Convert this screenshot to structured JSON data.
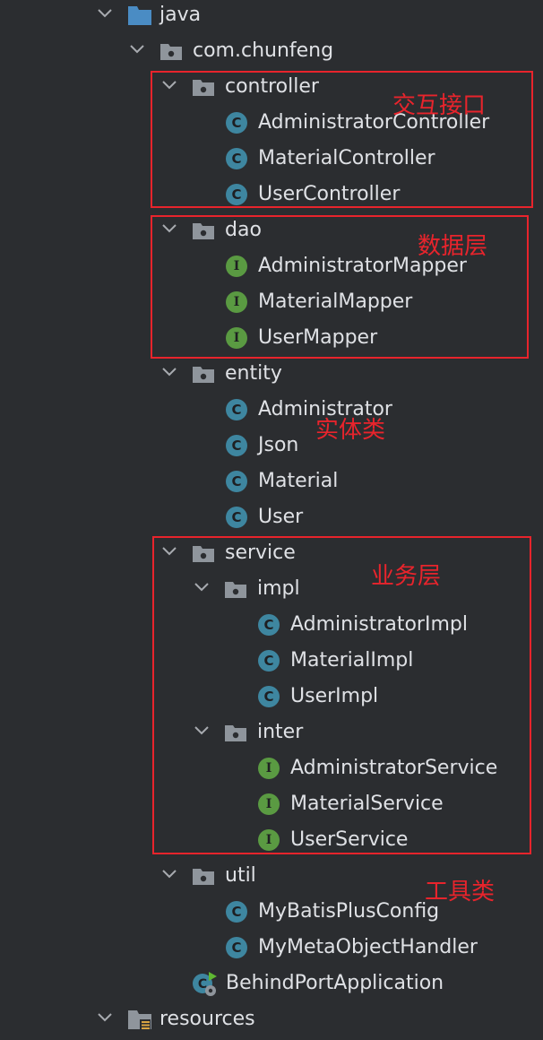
{
  "tree": {
    "java": "java",
    "com_chunfeng": "com.chunfeng",
    "controller": "controller",
    "controller_items": [
      "AdministratorController",
      "MaterialController",
      "UserController"
    ],
    "dao": "dao",
    "dao_items": [
      "AdministratorMapper",
      "MaterialMapper",
      "UserMapper"
    ],
    "entity": "entity",
    "entity_items": [
      "Administrator",
      "Json",
      "Material",
      "User"
    ],
    "service": "service",
    "impl": "impl",
    "impl_items": [
      "AdministratorImpl",
      "MaterialImpl",
      "UserImpl"
    ],
    "inter": "inter",
    "inter_items": [
      "AdministratorService",
      "MaterialService",
      "UserService"
    ],
    "util": "util",
    "util_items": [
      "MyBatisPlusConfig",
      "MyMetaObjectHandler"
    ],
    "app": "BehindPortApplication",
    "resources": "resources"
  },
  "icon_glyphs": {
    "class": "C",
    "interface": "I"
  },
  "annotations": {
    "controller": "交互接口",
    "dao": "数据层",
    "entity": "实体类",
    "service": "业务层",
    "util": "工具类"
  },
  "colors": {
    "background": "#2b2d30",
    "text": "#dfe1e5",
    "class_icon": "#3e86a0",
    "interface_icon": "#5a9a42",
    "highlight_box": "#e8242c"
  }
}
